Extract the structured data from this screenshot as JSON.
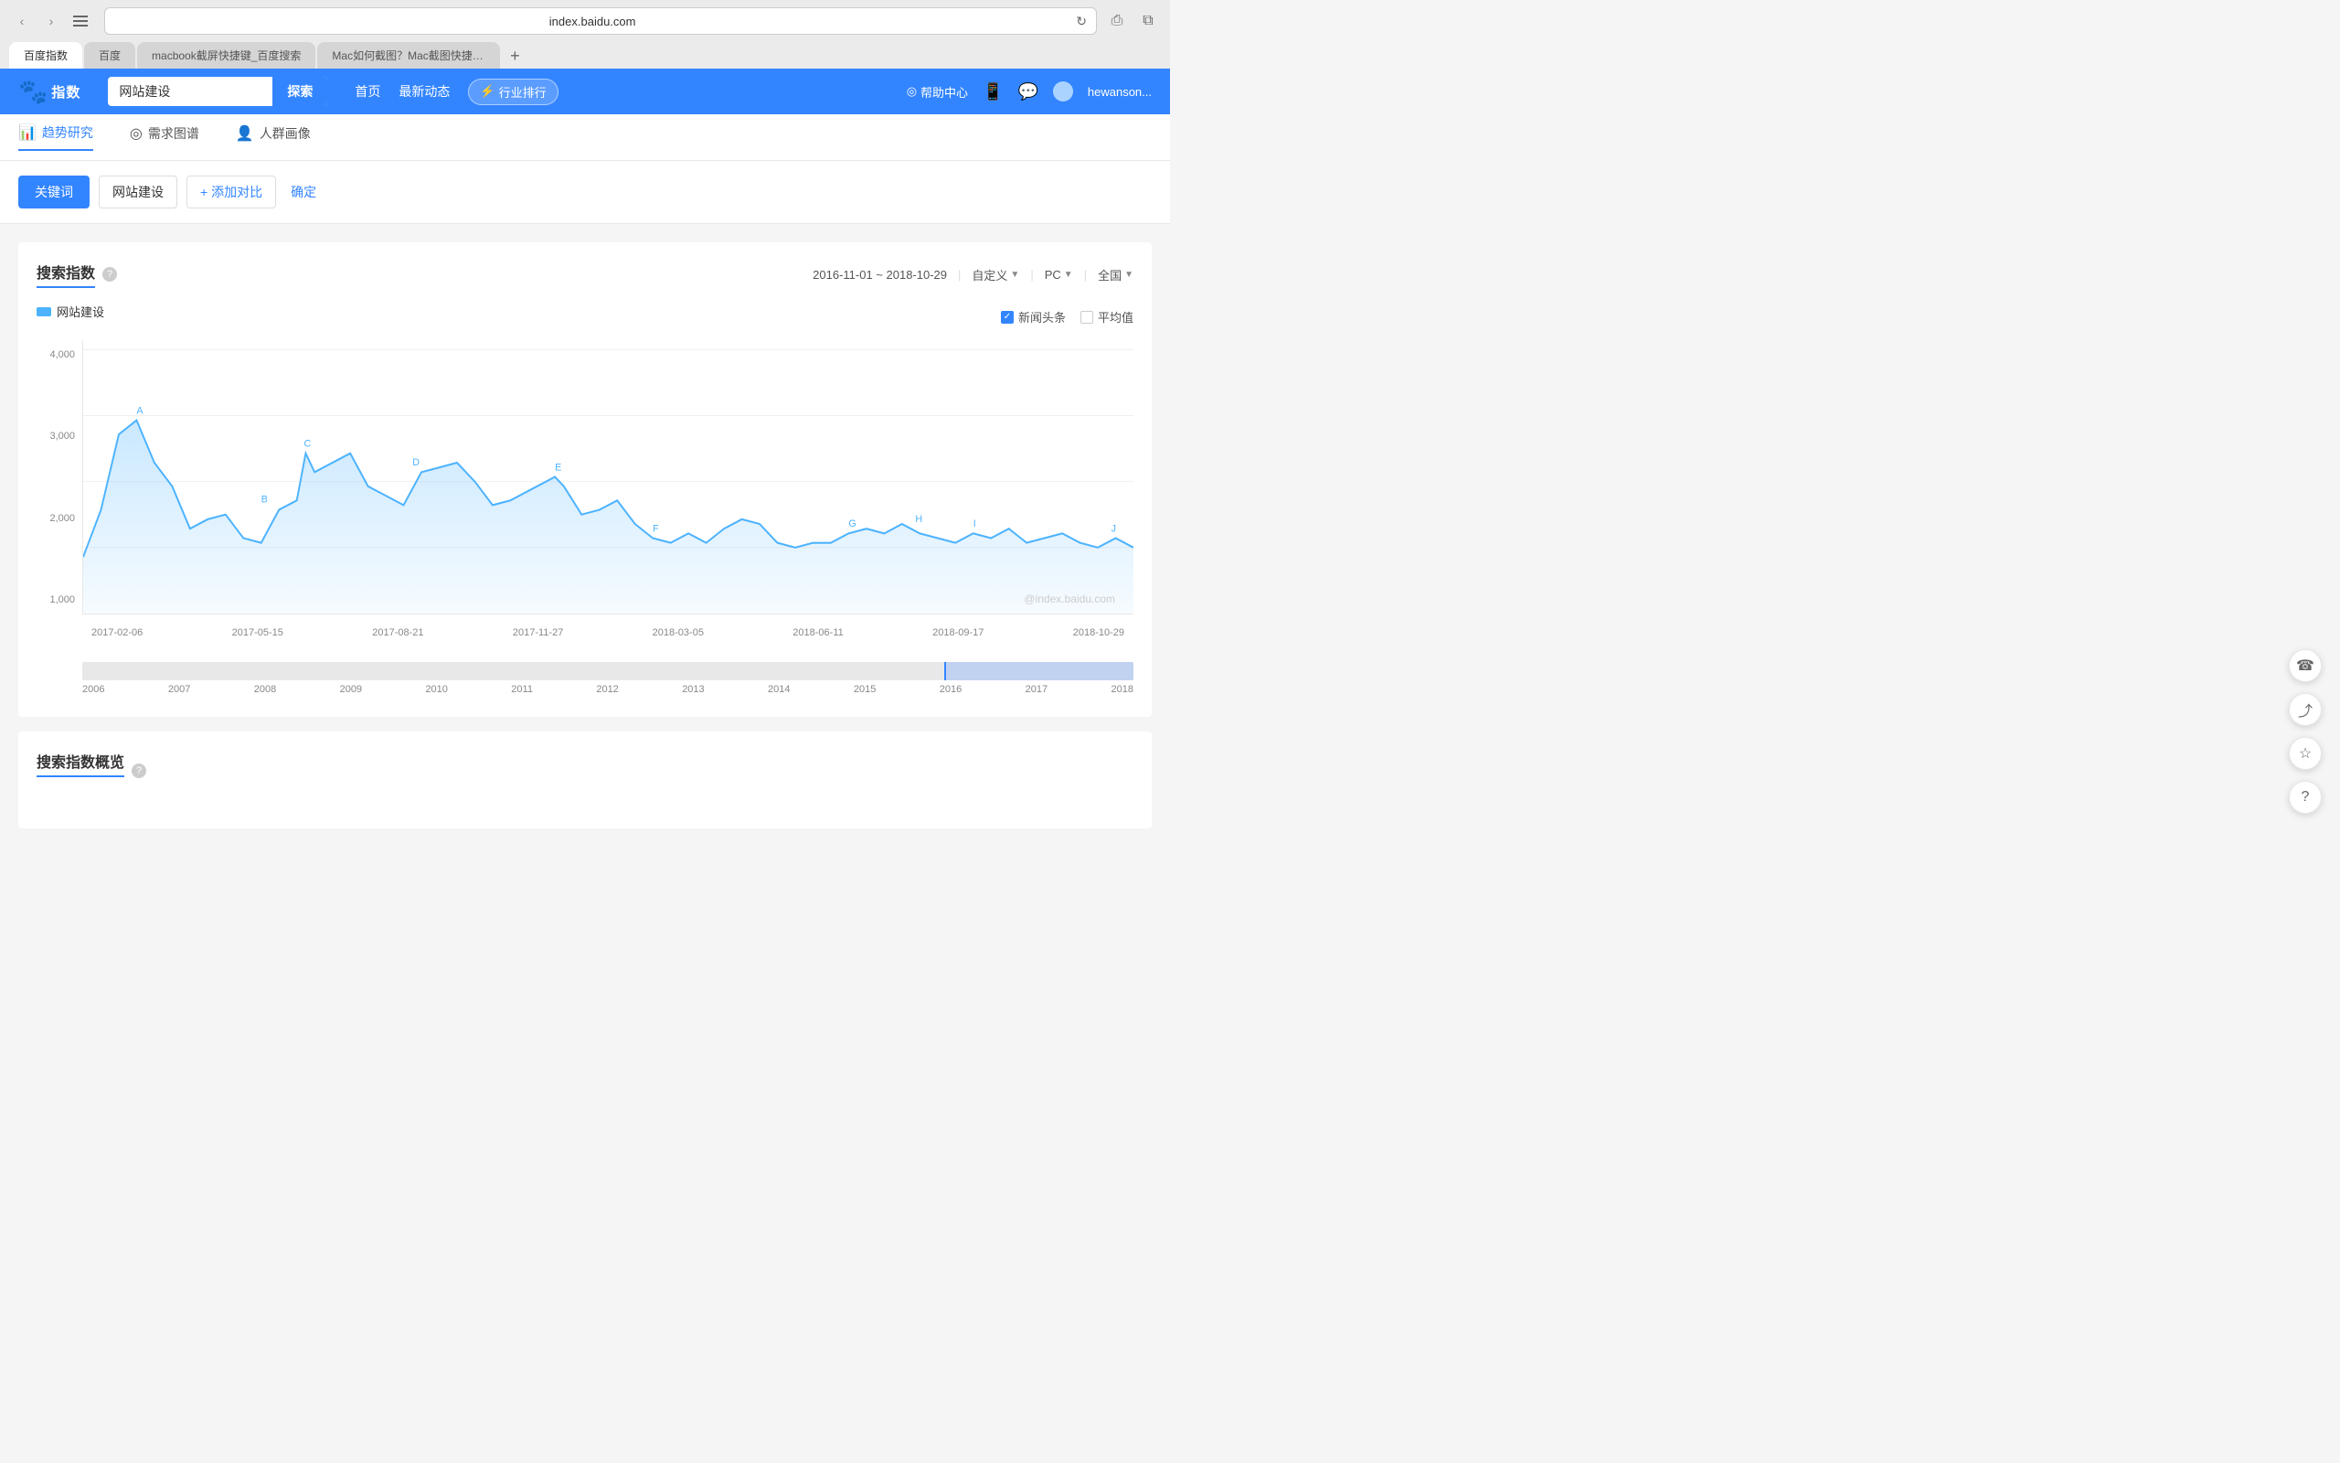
{
  "browser": {
    "url": "index.baidu.com",
    "tabs": [
      {
        "label": "百度指数",
        "active": true
      },
      {
        "label": "百度",
        "active": false
      },
      {
        "label": "macbook截屏快捷键_百度搜索",
        "active": false
      },
      {
        "label": "Mac如何截图？Mac截图快捷键_笔记本电脑_百度...",
        "active": false
      }
    ],
    "new_tab_label": "+"
  },
  "header": {
    "logo": "Baidu指数",
    "search_placeholder": "网站建设",
    "search_btn": "探索",
    "nav": {
      "home": "首页",
      "latest": "最新动态",
      "industry": "行业排行",
      "industry_icon": "⚡"
    },
    "help": "帮助中心",
    "username": "hewanson..."
  },
  "sub_nav": {
    "items": [
      {
        "label": "趋势研究",
        "icon": "📊",
        "active": true
      },
      {
        "label": "需求图谱",
        "icon": "◉",
        "active": false
      },
      {
        "label": "人群画像",
        "icon": "👤",
        "active": false
      }
    ]
  },
  "keyword_bar": {
    "keyword_btn": "关键词",
    "keyword": "网站建设",
    "add_compare": "+ 添加对比",
    "confirm": "确定"
  },
  "search_index": {
    "title": "搜索指数",
    "date_range": "2016-11-01 ~ 2018-10-29",
    "custom_label": "自定义",
    "pc_label": "PC",
    "region_label": "全国",
    "legend_label": "网站建设",
    "news_headline": "新闻头条",
    "avg_value": "平均值",
    "watermark": "@index.baidu.com",
    "y_axis": [
      "4,000",
      "3,000",
      "2,000",
      "1,000"
    ],
    "x_axis": [
      "2017-02-06",
      "2017-05-15",
      "2017-08-21",
      "2017-11-27",
      "2018-03-05",
      "2018-06-11",
      "2018-09-17",
      "2018-10-29"
    ],
    "annotations": [
      "A",
      "B",
      "C",
      "D",
      "E",
      "F",
      "G",
      "H",
      "I",
      "J"
    ],
    "mini_timeline_labels": [
      "2006",
      "2007",
      "2008",
      "2009",
      "2010",
      "2011",
      "2012",
      "2013",
      "2014",
      "2015",
      "2016",
      "2017",
      "2018"
    ]
  },
  "overview": {
    "title": "搜索指数概览",
    "help_icon": "?"
  },
  "float_buttons": {
    "support": "☎",
    "share": "⤴",
    "star": "☆",
    "help": "?"
  }
}
